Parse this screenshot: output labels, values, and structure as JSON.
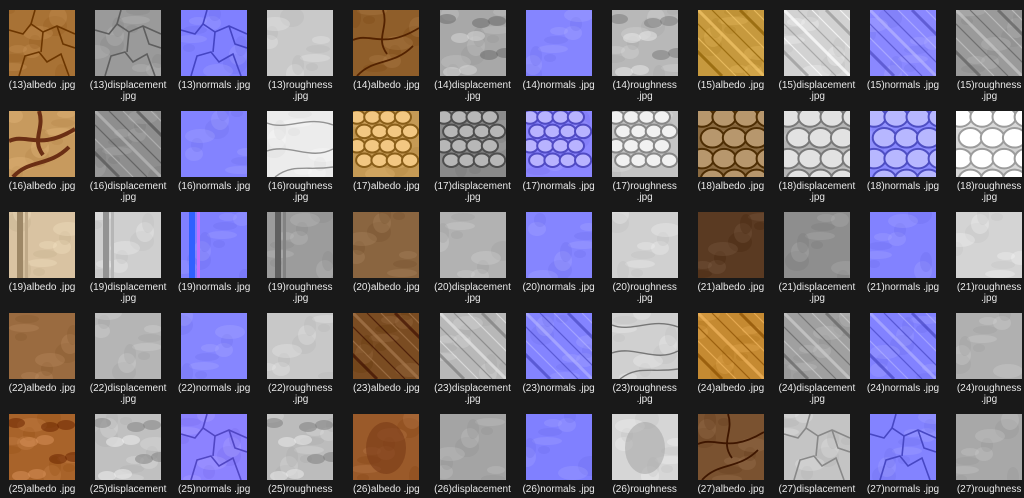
{
  "file_view": {
    "items": [
      {
        "label1": "(13)albedo .jpg",
        "label2": "",
        "type": "albedo",
        "variant": "cracked",
        "base": "#a87235"
      },
      {
        "label1": "(13)displacement",
        "label2": ".jpg",
        "type": "displacement",
        "variant": "cracked",
        "base": "#9a9a9a"
      },
      {
        "label1": "(13)normals .jpg",
        "label2": "",
        "type": "normals",
        "variant": "cracked",
        "base": "#8080ff"
      },
      {
        "label1": "(13)roughness",
        "label2": ".jpg",
        "type": "roughness",
        "variant": "soft",
        "base": "#c9c9c9"
      },
      {
        "label1": "(14)albedo .jpg",
        "label2": "",
        "type": "albedo",
        "variant": "veins",
        "base": "#8f5e2a"
      },
      {
        "label1": "(14)displacement",
        "label2": ".jpg",
        "type": "displacement",
        "variant": "blobs",
        "base": "#a8a8a8"
      },
      {
        "label1": "(14)normals .jpg",
        "label2": "",
        "type": "normals",
        "variant": "flat",
        "base": "#8585ff"
      },
      {
        "label1": "(14)roughness",
        "label2": ".jpg",
        "type": "roughness",
        "variant": "blobs",
        "base": "#b8b8b8"
      },
      {
        "label1": "(15)albedo .jpg",
        "label2": "",
        "type": "albedo",
        "variant": "diagonal",
        "base": "#c6993e"
      },
      {
        "label1": "(15)displacement",
        "label2": ".jpg",
        "type": "displacement",
        "variant": "diagonal",
        "base": "#d2d2d2"
      },
      {
        "label1": "(15)normals .jpg",
        "label2": "",
        "type": "normals",
        "variant": "diagonal",
        "base": "#8a88ff"
      },
      {
        "label1": "(15)roughness",
        "label2": ".jpg",
        "type": "roughness",
        "variant": "diagonal",
        "base": "#9a9a9a"
      },
      {
        "label1": "(16)albedo .jpg",
        "label2": "",
        "type": "albedo",
        "variant": "roots",
        "base": "#c79a5e"
      },
      {
        "label1": "(16)displacement",
        "label2": ".jpg",
        "type": "displacement",
        "variant": "diagonal",
        "base": "#8e8e8e"
      },
      {
        "label1": "(16)normals .jpg",
        "label2": "",
        "type": "normals",
        "variant": "flat",
        "base": "#8383ff"
      },
      {
        "label1": "(16)roughness",
        "label2": ".jpg",
        "type": "roughness",
        "variant": "marble",
        "base": "#ececec"
      },
      {
        "label1": "(17)albedo .jpg",
        "label2": "",
        "type": "albedo",
        "variant": "stones",
        "base": "#c59a55"
      },
      {
        "label1": "(17)displacement",
        "label2": ".jpg",
        "type": "displacement",
        "variant": "stones",
        "base": "#8a8a8a"
      },
      {
        "label1": "(17)normals .jpg",
        "label2": "",
        "type": "normals",
        "variant": "stones",
        "base": "#8b86ff"
      },
      {
        "label1": "(17)roughness",
        "label2": ".jpg",
        "type": "roughness",
        "variant": "stones",
        "base": "#c4c4c4"
      },
      {
        "label1": "(18)albedo .jpg",
        "label2": "",
        "type": "albedo",
        "variant": "boulders",
        "base": "#8a6a40"
      },
      {
        "label1": "(18)displacement",
        "label2": ".jpg",
        "type": "displacement",
        "variant": "boulders",
        "base": "#b5b5b5"
      },
      {
        "label1": "(18)normals .jpg",
        "label2": "",
        "type": "normals",
        "variant": "boulders",
        "base": "#8a8aff"
      },
      {
        "label1": "(18)roughness",
        "label2": ".jpg",
        "type": "roughness",
        "variant": "boulders",
        "base": "#d8d8d8"
      },
      {
        "label1": "(19)albedo .jpg",
        "label2": "",
        "type": "albedo",
        "variant": "plank",
        "base": "#d9c3a2"
      },
      {
        "label1": "(19)displacement",
        "label2": ".jpg",
        "type": "displacement",
        "variant": "plank",
        "base": "#cfcfcf"
      },
      {
        "label1": "(19)normals .jpg",
        "label2": "",
        "type": "normals",
        "variant": "plank",
        "base": "#8080ff"
      },
      {
        "label1": "(19)roughness",
        "label2": ".jpg",
        "type": "roughness",
        "variant": "plank",
        "base": "#9c9c9c"
      },
      {
        "label1": "(20)albedo .jpg",
        "label2": "",
        "type": "albedo",
        "variant": "soft",
        "base": "#8a6540"
      },
      {
        "label1": "(20)displacement",
        "label2": ".jpg",
        "type": "displacement",
        "variant": "soft",
        "base": "#b2b2b2"
      },
      {
        "label1": "(20)normals .jpg",
        "label2": "",
        "type": "normals",
        "variant": "soft",
        "base": "#8585ff"
      },
      {
        "label1": "(20)roughness",
        "label2": ".jpg",
        "type": "roughness",
        "variant": "soft",
        "base": "#d0d0d0"
      },
      {
        "label1": "(21)albedo .jpg",
        "label2": "",
        "type": "albedo",
        "variant": "soft",
        "base": "#5a3a22"
      },
      {
        "label1": "(21)displacement",
        "label2": ".jpg",
        "type": "displacement",
        "variant": "soft",
        "base": "#8e8e8e"
      },
      {
        "label1": "(21)normals .jpg",
        "label2": "",
        "type": "normals",
        "variant": "soft",
        "base": "#8282ff"
      },
      {
        "label1": "(21)roughness",
        "label2": ".jpg",
        "type": "roughness",
        "variant": "soft",
        "base": "#d4d4d4"
      },
      {
        "label1": "(22)albedo .jpg",
        "label2": "",
        "type": "albedo",
        "variant": "soft",
        "base": "#9a6b40"
      },
      {
        "label1": "(22)displacement",
        "label2": ".jpg",
        "type": "displacement",
        "variant": "soft",
        "base": "#b5b5b5"
      },
      {
        "label1": "(22)normals .jpg",
        "label2": "",
        "type": "normals",
        "variant": "soft",
        "base": "#8686ff"
      },
      {
        "label1": "(22)roughness",
        "label2": ".jpg",
        "type": "roughness",
        "variant": "soft",
        "base": "#c8c8c8"
      },
      {
        "label1": "(23)albedo .jpg",
        "label2": "",
        "type": "albedo",
        "variant": "diagonal",
        "base": "#7a4c22"
      },
      {
        "label1": "(23)displacement",
        "label2": ".jpg",
        "type": "displacement",
        "variant": "diagonal",
        "base": "#b8b8b8"
      },
      {
        "label1": "(23)normals .jpg",
        "label2": "",
        "type": "normals",
        "variant": "diagonal",
        "base": "#8484ff"
      },
      {
        "label1": "(23)roughness",
        "label2": ".jpg",
        "type": "roughness",
        "variant": "marble",
        "base": "#d0d0d0"
      },
      {
        "label1": "(24)albedo .jpg",
        "label2": "",
        "type": "albedo",
        "variant": "diagonal",
        "base": "#c58a32"
      },
      {
        "label1": "(24)displacement",
        "label2": ".jpg",
        "type": "displacement",
        "variant": "diagonal",
        "base": "#a0a0a0"
      },
      {
        "label1": "(24)normals .jpg",
        "label2": "",
        "type": "normals",
        "variant": "diagonal",
        "base": "#8282ff"
      },
      {
        "label1": "(24)roughness",
        "label2": ".jpg",
        "type": "roughness",
        "variant": "soft",
        "base": "#b0b0b0"
      },
      {
        "label1": "(25)albedo .jpg",
        "label2": "",
        "type": "albedo",
        "variant": "blobs",
        "base": "#a8632a"
      },
      {
        "label1": "(25)displacement",
        "label2": "",
        "type": "displacement",
        "variant": "blobs",
        "base": "#c0c0c0"
      },
      {
        "label1": "(25)normals .jpg",
        "label2": "",
        "type": "normals",
        "variant": "cracked",
        "base": "#8c82ff"
      },
      {
        "label1": "(25)roughness",
        "label2": "",
        "type": "roughness",
        "variant": "blobs",
        "base": "#bcbcbc"
      },
      {
        "label1": "(26)albedo .jpg",
        "label2": "",
        "type": "albedo",
        "variant": "stain",
        "base": "#9a5a2a"
      },
      {
        "label1": "(26)displacement",
        "label2": "",
        "type": "displacement",
        "variant": "soft",
        "base": "#a4a4a4"
      },
      {
        "label1": "(26)normals .jpg",
        "label2": "",
        "type": "normals",
        "variant": "flat",
        "base": "#8080ff"
      },
      {
        "label1": "(26)roughness",
        "label2": "",
        "type": "roughness",
        "variant": "stain",
        "base": "#d6d6d6"
      },
      {
        "label1": "(27)albedo .jpg",
        "label2": "",
        "type": "albedo",
        "variant": "veins",
        "base": "#7a5230"
      },
      {
        "label1": "(27)displacement",
        "label2": "",
        "type": "displacement",
        "variant": "cracked",
        "base": "#c4c4c4"
      },
      {
        "label1": "(27)normals .jpg",
        "label2": "",
        "type": "normals",
        "variant": "cracked",
        "base": "#8383ff"
      },
      {
        "label1": "(27)roughness",
        "label2": "",
        "type": "roughness",
        "variant": "soft",
        "base": "#a8a8a8"
      }
    ]
  }
}
